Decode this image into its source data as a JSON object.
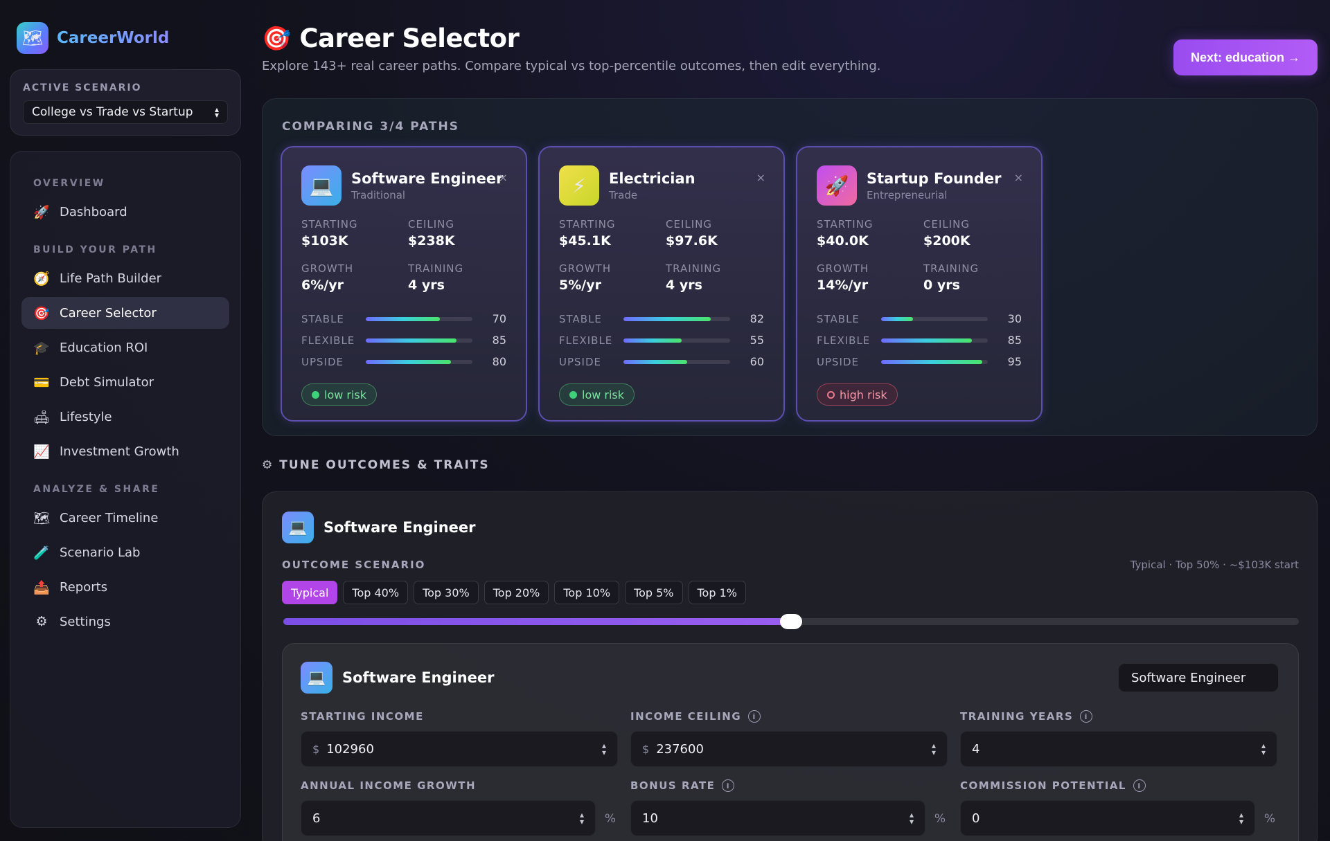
{
  "app": {
    "name": "CareerWorld"
  },
  "scenario": {
    "label": "ACTIVE SCENARIO",
    "selected": "College vs Trade vs Startup"
  },
  "nav": {
    "groups": [
      {
        "label": "OVERVIEW",
        "items": [
          {
            "label": "Dashboard",
            "icon": "🚀"
          }
        ]
      },
      {
        "label": "BUILD YOUR PATH",
        "items": [
          {
            "label": "Life Path Builder",
            "icon": "🧭"
          },
          {
            "label": "Career Selector",
            "icon": "🎯",
            "active": true
          },
          {
            "label": "Education ROI",
            "icon": "🎓"
          },
          {
            "label": "Debt Simulator",
            "icon": "💳"
          },
          {
            "label": "Lifestyle",
            "icon": "🛋"
          },
          {
            "label": "Investment Growth",
            "icon": "📈"
          }
        ]
      },
      {
        "label": "ANALYZE & SHARE",
        "items": [
          {
            "label": "Career Timeline",
            "icon": "🗺"
          },
          {
            "label": "Scenario Lab",
            "icon": "🧪"
          },
          {
            "label": "Reports",
            "icon": "📤"
          },
          {
            "label": "Settings",
            "icon": "⚙"
          }
        ]
      }
    ]
  },
  "header": {
    "icon": "🎯",
    "title": "Career Selector",
    "subtitle": "Explore 143+ real career paths. Compare typical vs top-percentile outcomes, then edit everything.",
    "next_button": "Next: education →"
  },
  "compare": {
    "label": "COMPARING 3/4 PATHS",
    "stat_labels": {
      "starting": "STARTING",
      "ceiling": "CEILING",
      "growth": "GROWTH",
      "training": "TRAINING"
    },
    "bar_labels": {
      "stable": "STABLE",
      "flexible": "FLEXIBLE",
      "upside": "UPSIDE"
    },
    "cards": [
      {
        "title": "Software Engineer",
        "category": "Traditional",
        "icon": "💻",
        "icon_bg": "linear-gradient(135deg,#7c8cff,#3ab0e8)",
        "starting": "$103K",
        "ceiling": "$238K",
        "growth": "6%/yr",
        "training": "4 yrs",
        "stable": 70,
        "flexible": 85,
        "upside": 80,
        "risk": "low risk",
        "risk_level": "low"
      },
      {
        "title": "Electrician",
        "category": "Trade",
        "icon": "⚡",
        "icon_bg": "linear-gradient(135deg,#f0e04a,#c9d62a)",
        "starting": "$45.1K",
        "ceiling": "$97.6K",
        "growth": "5%/yr",
        "training": "4 yrs",
        "stable": 82,
        "flexible": 55,
        "upside": 60,
        "risk": "low risk",
        "risk_level": "low"
      },
      {
        "title": "Startup Founder",
        "category": "Entrepreneurial",
        "icon": "🚀",
        "icon_bg": "linear-gradient(135deg,#c04ef0,#f06aa0)",
        "starting": "$40.0K",
        "ceiling": "$200K",
        "growth": "14%/yr",
        "training": "0 yrs",
        "stable": 30,
        "flexible": 85,
        "upside": 95,
        "risk": "high risk",
        "risk_level": "high"
      }
    ],
    "close_symbol": "×"
  },
  "tune": {
    "icon": "⚙",
    "heading": "TUNE OUTCOMES & TRAITS",
    "career_name": "Software Engineer",
    "career_icon": "💻",
    "outcome_label": "OUTCOME SCENARIO",
    "outcome_info": "Typical · Top 50% · ~$103K start",
    "pills": [
      "Typical",
      "Top 40%",
      "Top 30%",
      "Top 20%",
      "Top 10%",
      "Top 5%",
      "Top 1%"
    ],
    "active_pill": 0,
    "slider_fraction": 0.5
  },
  "editor": {
    "title": "Software Engineer",
    "icon": "💻",
    "career_select": "Software Engineer",
    "fields": {
      "starting_income": {
        "label": "STARTING INCOME",
        "prefix": "$",
        "value": "102960"
      },
      "income_ceiling": {
        "label": "INCOME CEILING",
        "prefix": "$",
        "value": "237600"
      },
      "training_years": {
        "label": "TRAINING YEARS",
        "value": "4"
      },
      "annual_growth": {
        "label": "ANNUAL INCOME GROWTH",
        "value": "6",
        "suffix": "%"
      },
      "bonus_rate": {
        "label": "BONUS RATE",
        "value": "10",
        "suffix": "%"
      },
      "commission": {
        "label": "COMMISSION POTENTIAL",
        "value": "0",
        "suffix": "%"
      }
    },
    "info_symbol": "i"
  }
}
